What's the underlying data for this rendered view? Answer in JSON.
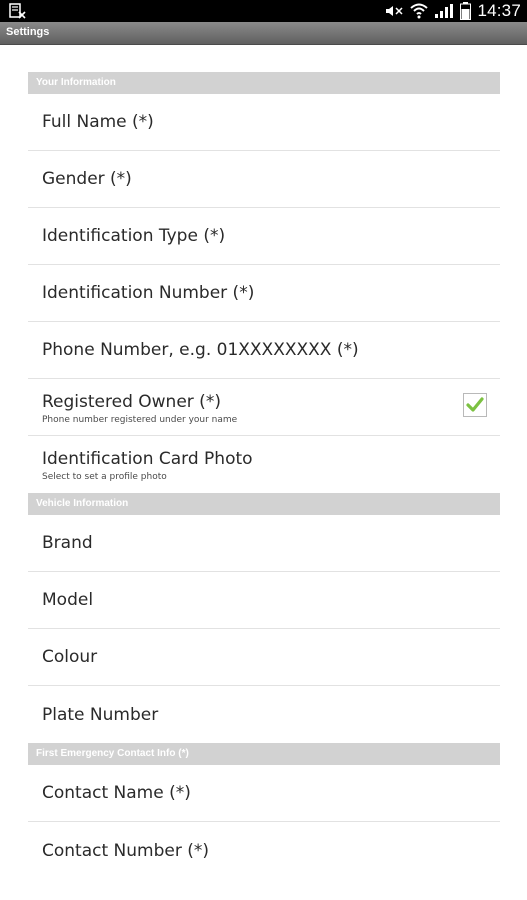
{
  "status_bar": {
    "time": "14:37",
    "icons": [
      "notification-icon",
      "mute-icon",
      "wifi-icon",
      "signal-icon",
      "battery-icon"
    ]
  },
  "title_bar": {
    "title": "Settings"
  },
  "sections": [
    {
      "header": "Your Information",
      "items": [
        {
          "title": "Full Name (*)"
        },
        {
          "title": "Gender (*)"
        },
        {
          "title": "Identification Type (*)"
        },
        {
          "title": "Identification Number (*)"
        },
        {
          "title": "Phone Number, e.g. 01XXXXXXXX (*)"
        },
        {
          "title": "Registered Owner (*)",
          "summary": "Phone number registered under your name",
          "checked": true
        },
        {
          "title": "Identification Card Photo",
          "summary": "Select to set a profile photo"
        }
      ]
    },
    {
      "header": "Vehicle Information",
      "items": [
        {
          "title": "Brand"
        },
        {
          "title": "Model"
        },
        {
          "title": "Colour"
        },
        {
          "title": "Plate Number"
        }
      ]
    },
    {
      "header": "First Emergency Contact Info (*)",
      "items": [
        {
          "title": "Contact Name (*)"
        },
        {
          "title": "Contact Number (*)"
        }
      ]
    }
  ],
  "colors": {
    "check": "#7cc142",
    "header_bg": "#d2d2d2",
    "status_bg": "#000000"
  }
}
